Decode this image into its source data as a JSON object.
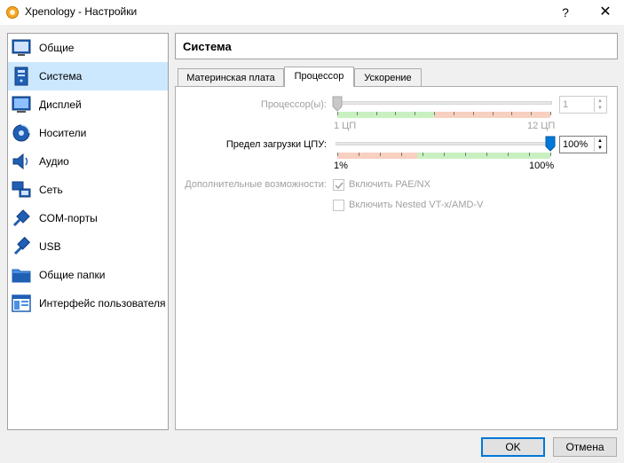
{
  "window": {
    "title": "Xpenology - Настройки",
    "help": "?",
    "close": "✕"
  },
  "sidebar": {
    "items": [
      {
        "label": "Общие",
        "icon": "general-icon",
        "selected": false
      },
      {
        "label": "Система",
        "icon": "system-icon",
        "selected": true
      },
      {
        "label": "Дисплей",
        "icon": "display-icon",
        "selected": false
      },
      {
        "label": "Носители",
        "icon": "storage-icon",
        "selected": false
      },
      {
        "label": "Аудио",
        "icon": "audio-icon",
        "selected": false
      },
      {
        "label": "Сеть",
        "icon": "network-icon",
        "selected": false
      },
      {
        "label": "COM-порты",
        "icon": "serial-ports-icon",
        "selected": false
      },
      {
        "label": "USB",
        "icon": "usb-icon",
        "selected": false
      },
      {
        "label": "Общие папки",
        "icon": "shared-folders-icon",
        "selected": false
      },
      {
        "label": "Интерфейс пользователя",
        "icon": "user-interface-icon",
        "selected": false
      }
    ]
  },
  "section": {
    "title": "Система"
  },
  "tabs": [
    {
      "label": "Материнская плата",
      "active": false
    },
    {
      "label": "Процессор",
      "active": true
    },
    {
      "label": "Ускорение",
      "active": false
    }
  ],
  "processor": {
    "cpu_label": "Процессор(ы):",
    "cpu_min": "1 ЦП",
    "cpu_max": "12 ЦП",
    "cpu_value": "1",
    "cpu_count": 1,
    "cpu_range": [
      1,
      12
    ],
    "cap_label": "Предел загрузки ЦПУ:",
    "cap_min": "1%",
    "cap_max": "100%",
    "cap_value": "100%",
    "cap_level": 100,
    "extended_label": "Дополнительные возможности:",
    "pae_label": "Включить PAE/NX",
    "pae_checked": true,
    "nested_label": "Включить Nested VT-x/AMD-V",
    "nested_checked": false
  },
  "buttons": {
    "ok": "OK",
    "cancel": "Отмена"
  },
  "colors": {
    "accent": "#0078d7",
    "selected_bg": "#cce8ff",
    "green_band": "#c8f0c0",
    "red_band": "#f8d0c0"
  }
}
